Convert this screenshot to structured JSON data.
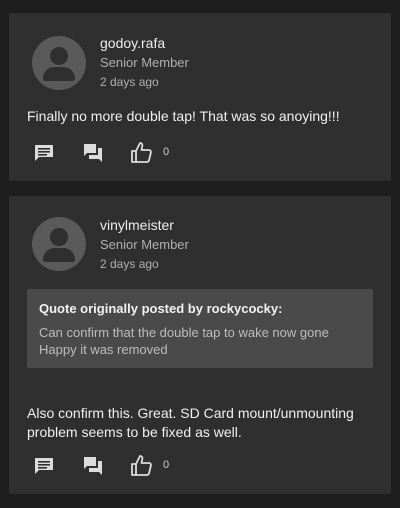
{
  "posts": [
    {
      "username": "godoy.rafa",
      "role": "Senior Member",
      "time": "2 days ago",
      "body": "Finally no more double tap! That was so anoying!!!",
      "like_count": "0"
    },
    {
      "username": "vinylmeister",
      "role": "Senior Member",
      "time": "2 days ago",
      "quote": {
        "title": "Quote originally posted by rockycocky:",
        "body": "Can confirm that the double tap to wake now gone Happy it was removed"
      },
      "body": "Also confirm this. Great. SD Card mount/unmounting problem seems to be fixed as well.",
      "like_count": "0"
    }
  ],
  "icons": [
    "comment-icon",
    "forum-icon",
    "thumb-up-icon"
  ]
}
